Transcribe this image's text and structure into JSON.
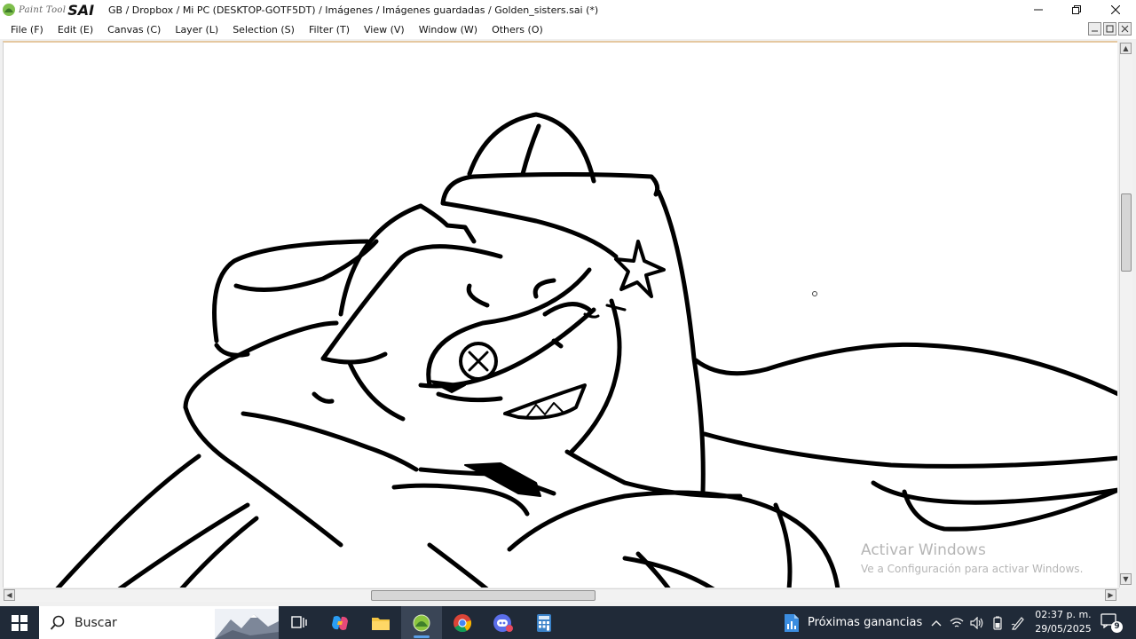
{
  "app": {
    "logo_script": "Paint Tool",
    "logo_name": "SAI",
    "window_title": "GB / Dropbox / Mi PC (DESKTOP-GOTF5DT) / Imágenes / Imágenes guardadas / Golden_sisters.sai (*)"
  },
  "menu": [
    {
      "label": "File (F)"
    },
    {
      "label": "Edit (E)"
    },
    {
      "label": "Canvas (C)"
    },
    {
      "label": "Layer (L)"
    },
    {
      "label": "Selection (S)"
    },
    {
      "label": "Filter (T)"
    },
    {
      "label": "View (V)"
    },
    {
      "label": "Window (W)"
    },
    {
      "label": "Others (O)"
    }
  ],
  "watermark": {
    "title": "Activar Windows",
    "subtitle": "Ve a Configuración para activar Windows."
  },
  "taskbar": {
    "search_placeholder": "Buscar",
    "news_label": "Próximas ganancias",
    "time": "02:37 p. m.",
    "date": "29/05/2025",
    "notification_count": "9"
  },
  "colors": {
    "taskbar_bg": "#202a38",
    "accent": "#5aa0e8",
    "canvas_bg": "#ffffff"
  }
}
